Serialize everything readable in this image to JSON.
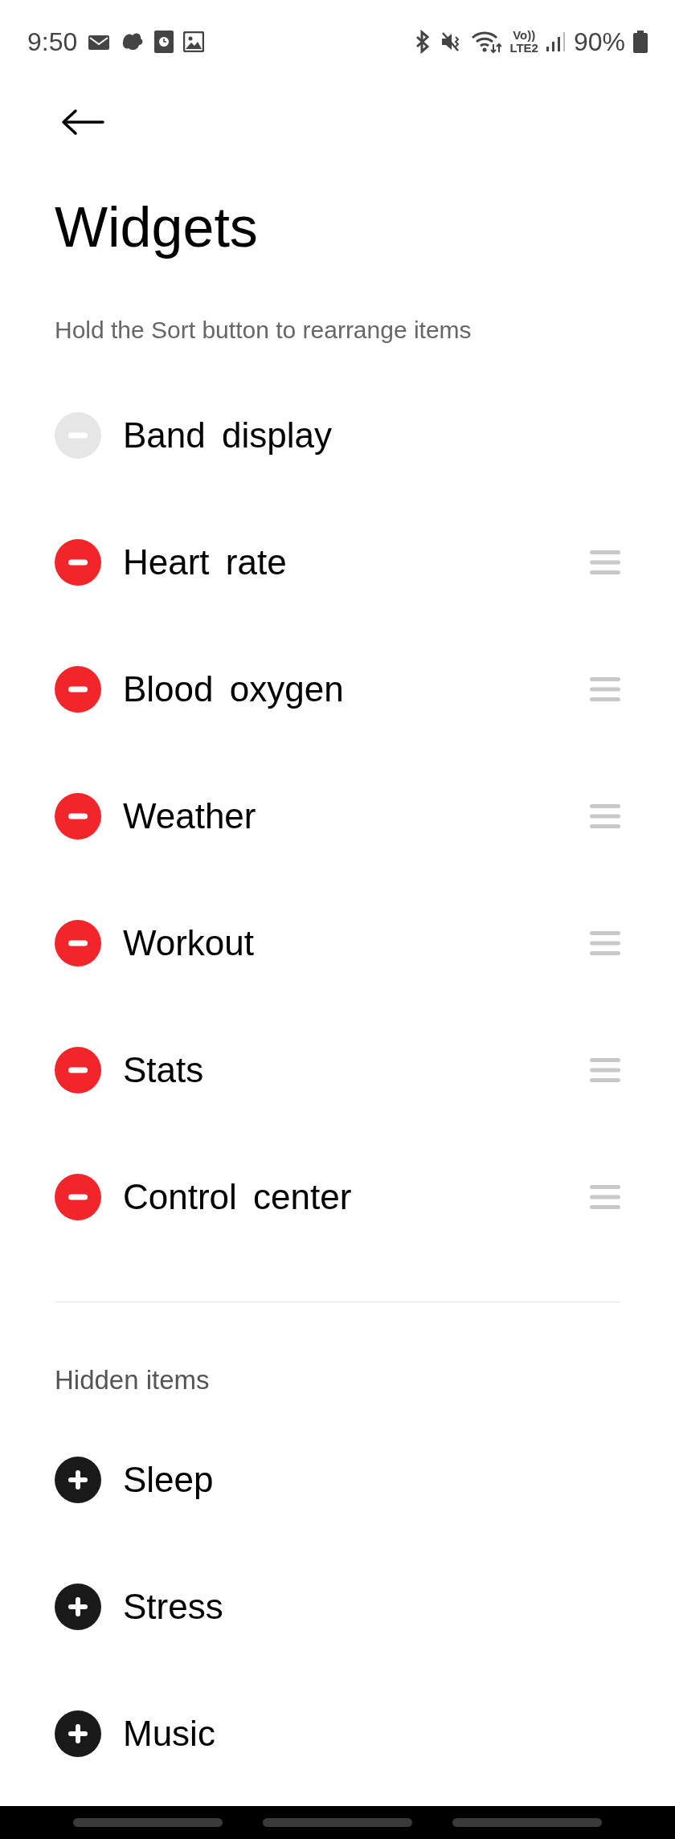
{
  "status_bar": {
    "time": "9:50",
    "volte_label": "Vo))",
    "network_label": "LTE2",
    "battery": "90%"
  },
  "header": {
    "title": "Widgets",
    "subtitle": "Hold the Sort button to rearrange items"
  },
  "shown_items": [
    {
      "label": "Band display",
      "disabled": true
    },
    {
      "label": "Heart rate",
      "disabled": false
    },
    {
      "label": "Blood oxygen",
      "disabled": false
    },
    {
      "label": "Weather",
      "disabled": false
    },
    {
      "label": "Workout",
      "disabled": false
    },
    {
      "label": "Stats",
      "disabled": false
    },
    {
      "label": "Control center",
      "disabled": false
    }
  ],
  "hidden_section": {
    "title": "Hidden items",
    "items": [
      {
        "label": "Sleep"
      },
      {
        "label": "Stress"
      },
      {
        "label": "Music"
      }
    ]
  }
}
